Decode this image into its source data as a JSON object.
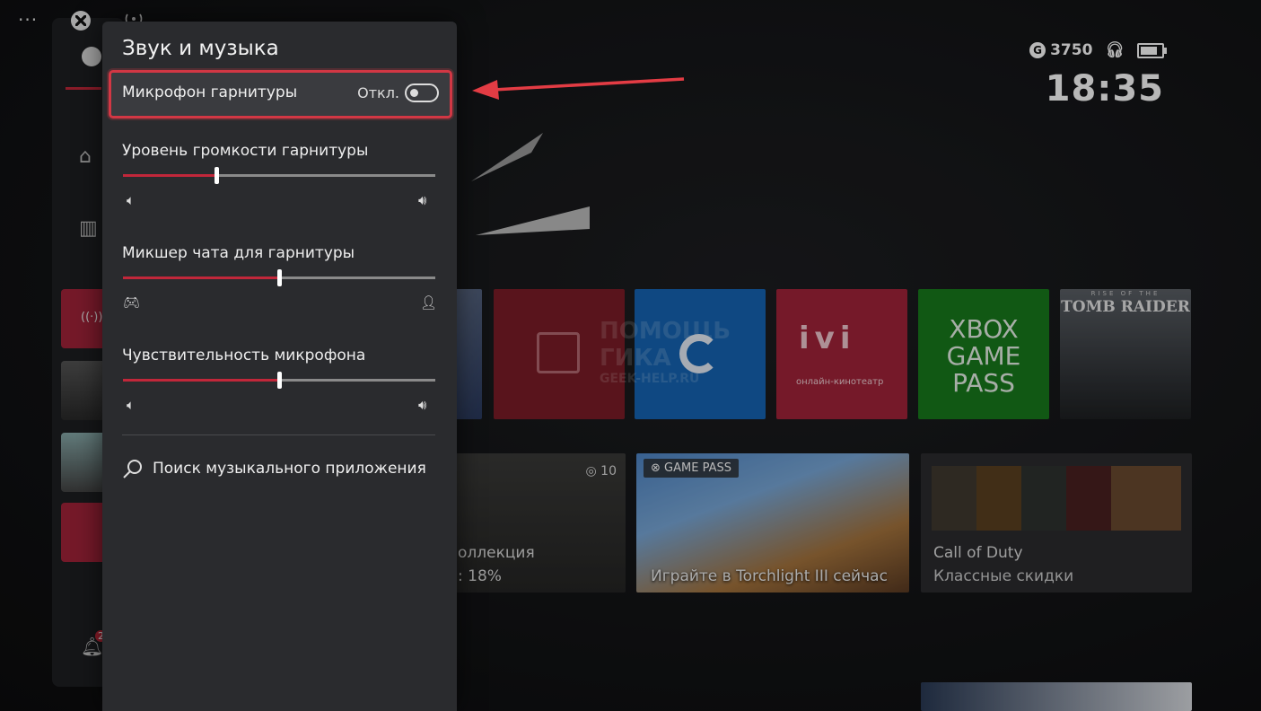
{
  "top": {
    "dots": "···"
  },
  "status": {
    "gamerscore": "3750",
    "time": "18:35"
  },
  "panel": {
    "title": "Звук и музыка",
    "mic": {
      "label": "Микрофон гарнитуры",
      "state": "Откл."
    },
    "sliders": [
      {
        "label": "Уровень громкости гарнитуры",
        "value": 0.3
      },
      {
        "label": "Микшер чата для гарнитуры",
        "value": 0.5
      },
      {
        "label": "Чувствительность микрофона",
        "value": 0.5
      }
    ],
    "search": {
      "label": "Поиск музыкального приложения"
    }
  },
  "tiles": {
    "collection": {
      "line1": "оллекция",
      "line2": ": 18%",
      "badge": "10"
    },
    "gamepass_banner": {
      "badge": "GAME PASS",
      "caption": "Играйте в Torchlight III сейчас"
    },
    "cod": {
      "title": "Call of Duty",
      "subtitle": "Классные скидки"
    },
    "ivi": {
      "caption": "онлайн-кинотеатр"
    },
    "xgp": {
      "line1": "XBOX",
      "line2": "GAME",
      "line3": "PASS"
    },
    "tomb": {
      "top": "RISE OF THE",
      "title": "TOMB RAIDER"
    },
    "watermark": {
      "line1": "ПОМОЩЬ",
      "line2": "ГИКА",
      "line3": "GEEK-HELP.RU"
    }
  },
  "rail": {
    "notification_count": "2"
  },
  "colors": {
    "accent": "#c1273a",
    "highlight": "#d23744",
    "panel": "#2a2b2e"
  }
}
